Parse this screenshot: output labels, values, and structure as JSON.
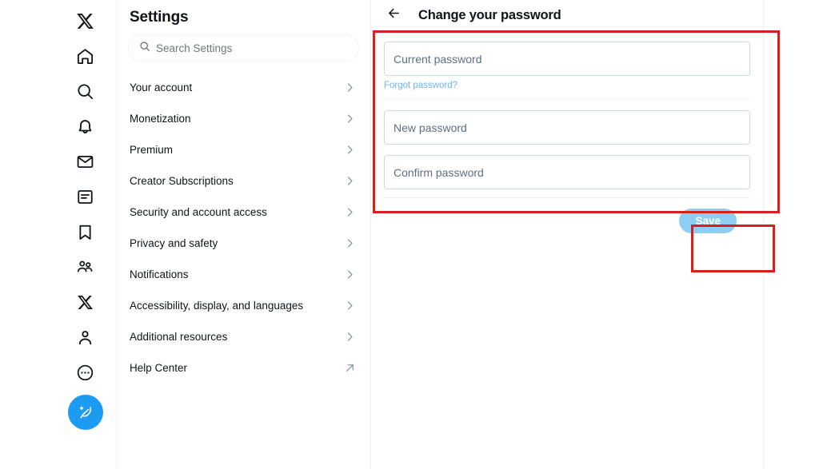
{
  "colors": {
    "brand_blue": "#1d9bf0",
    "save_button_bg": "#8ecdf4",
    "link_blue": "#6fb5e8",
    "annotation_red": "#d81f1f",
    "text_primary": "#0f1419",
    "text_muted": "#71767b",
    "border": "#cfd9de"
  },
  "nav_rail": {
    "items": [
      {
        "icon": "x-logo-icon",
        "label": "X"
      },
      {
        "icon": "home-icon",
        "label": "Home"
      },
      {
        "icon": "search-icon",
        "label": "Explore"
      },
      {
        "icon": "bell-icon",
        "label": "Notifications"
      },
      {
        "icon": "mail-icon",
        "label": "Messages"
      },
      {
        "icon": "list-icon",
        "label": "Lists"
      },
      {
        "icon": "bookmark-icon",
        "label": "Bookmarks"
      },
      {
        "icon": "communities-icon",
        "label": "Communities"
      },
      {
        "icon": "grok-x-icon",
        "label": "Grok"
      },
      {
        "icon": "profile-person-icon",
        "label": "Profile"
      },
      {
        "icon": "more-circle-icon",
        "label": "More"
      }
    ],
    "compose": {
      "icon": "compose-feather-plus-icon",
      "label": "Post"
    }
  },
  "settings": {
    "title": "Settings",
    "search": {
      "placeholder": "Search Settings",
      "value": "",
      "icon": "search-icon"
    },
    "items": [
      {
        "label": "Your account",
        "accessory": "chevron-right-icon"
      },
      {
        "label": "Monetization",
        "accessory": "chevron-right-icon"
      },
      {
        "label": "Premium",
        "accessory": "chevron-right-icon"
      },
      {
        "label": "Creator Subscriptions",
        "accessory": "chevron-right-icon"
      },
      {
        "label": "Security and account access",
        "accessory": "chevron-right-icon"
      },
      {
        "label": "Privacy and safety",
        "accessory": "chevron-right-icon"
      },
      {
        "label": "Notifications",
        "accessory": "chevron-right-icon"
      },
      {
        "label": "Accessibility, display, and languages",
        "accessory": "chevron-right-icon"
      },
      {
        "label": "Additional resources",
        "accessory": "chevron-right-icon"
      },
      {
        "label": "Help Center",
        "accessory": "external-link-icon"
      }
    ]
  },
  "main": {
    "back_icon": "arrow-left-icon",
    "title": "Change your password",
    "fields": [
      {
        "name": "current-password",
        "placeholder": "Current password",
        "value": ""
      },
      {
        "name": "new-password",
        "placeholder": "New password",
        "value": ""
      },
      {
        "name": "confirm-password",
        "placeholder": "Confirm password",
        "value": ""
      }
    ],
    "forgot_link": "Forgot password?",
    "save_label": "Save"
  }
}
